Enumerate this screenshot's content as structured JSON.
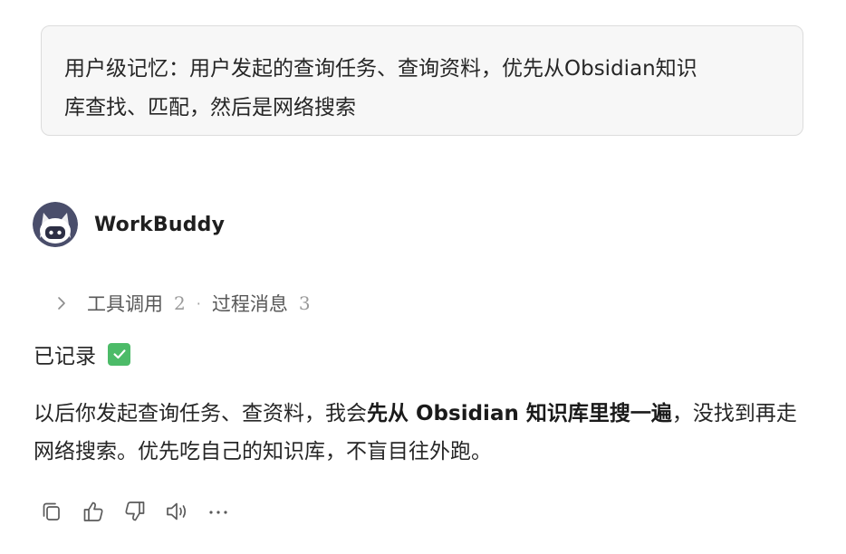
{
  "user_message": {
    "line1": "用户级记忆：用户发起的查询任务、查询资料，优先从Obsidian知识",
    "line2": "库查找、匹配，然后是网络搜索"
  },
  "assistant": {
    "name": "WorkBuddy",
    "avatar_icon": "robot-avatar-icon"
  },
  "process": {
    "tool_calls_label": "工具调用",
    "tool_calls_count": "2",
    "separator": "·",
    "messages_label": "过程消息",
    "messages_count": "3"
  },
  "reply": {
    "recorded_text": "已记录",
    "recorded_icon": "check-mark-icon",
    "body_pre": "以后你发起查询任务、查资料，我会",
    "body_bold": "先从 Obsidian 知识库里搜一遍",
    "body_post": "，没找到再走网络搜索。优先吃自己的知识库，不盲目往外跑。"
  },
  "actions": [
    "copy-icon",
    "thumbs-up-icon",
    "thumbs-down-icon",
    "read-aloud-icon",
    "more-icon"
  ],
  "colors": {
    "bubble_bg": "#f7f7f7",
    "bubble_border": "#dcdcdc",
    "check_green": "#4cbb68",
    "text": "#262626",
    "muted": "#595959"
  }
}
